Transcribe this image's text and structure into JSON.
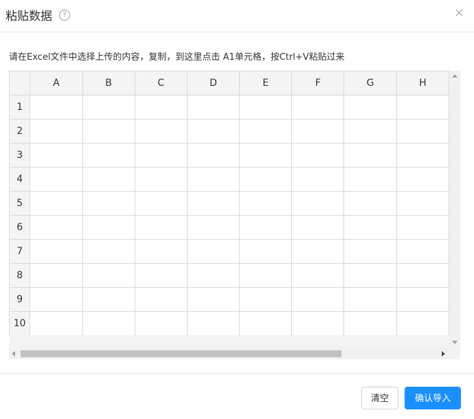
{
  "dialog": {
    "title": "粘贴数据",
    "help_icon": "?",
    "close_icon": "×"
  },
  "instruction": "请在Excel文件中选择上传的内容，复制，到这里点击 A1单元格，按Ctrl+V粘贴过来",
  "sheet": {
    "columns": [
      "A",
      "B",
      "C",
      "D",
      "E",
      "F",
      "G",
      "H"
    ],
    "rows": [
      "1",
      "2",
      "3",
      "4",
      "5",
      "6",
      "7",
      "8",
      "9",
      "10"
    ]
  },
  "footer": {
    "clear_label": "清空",
    "confirm_label": "确认导入"
  },
  "colors": {
    "primary": "#1a90ff",
    "header_bg": "#f4f4f4",
    "grid_border": "#d9d9d9"
  }
}
